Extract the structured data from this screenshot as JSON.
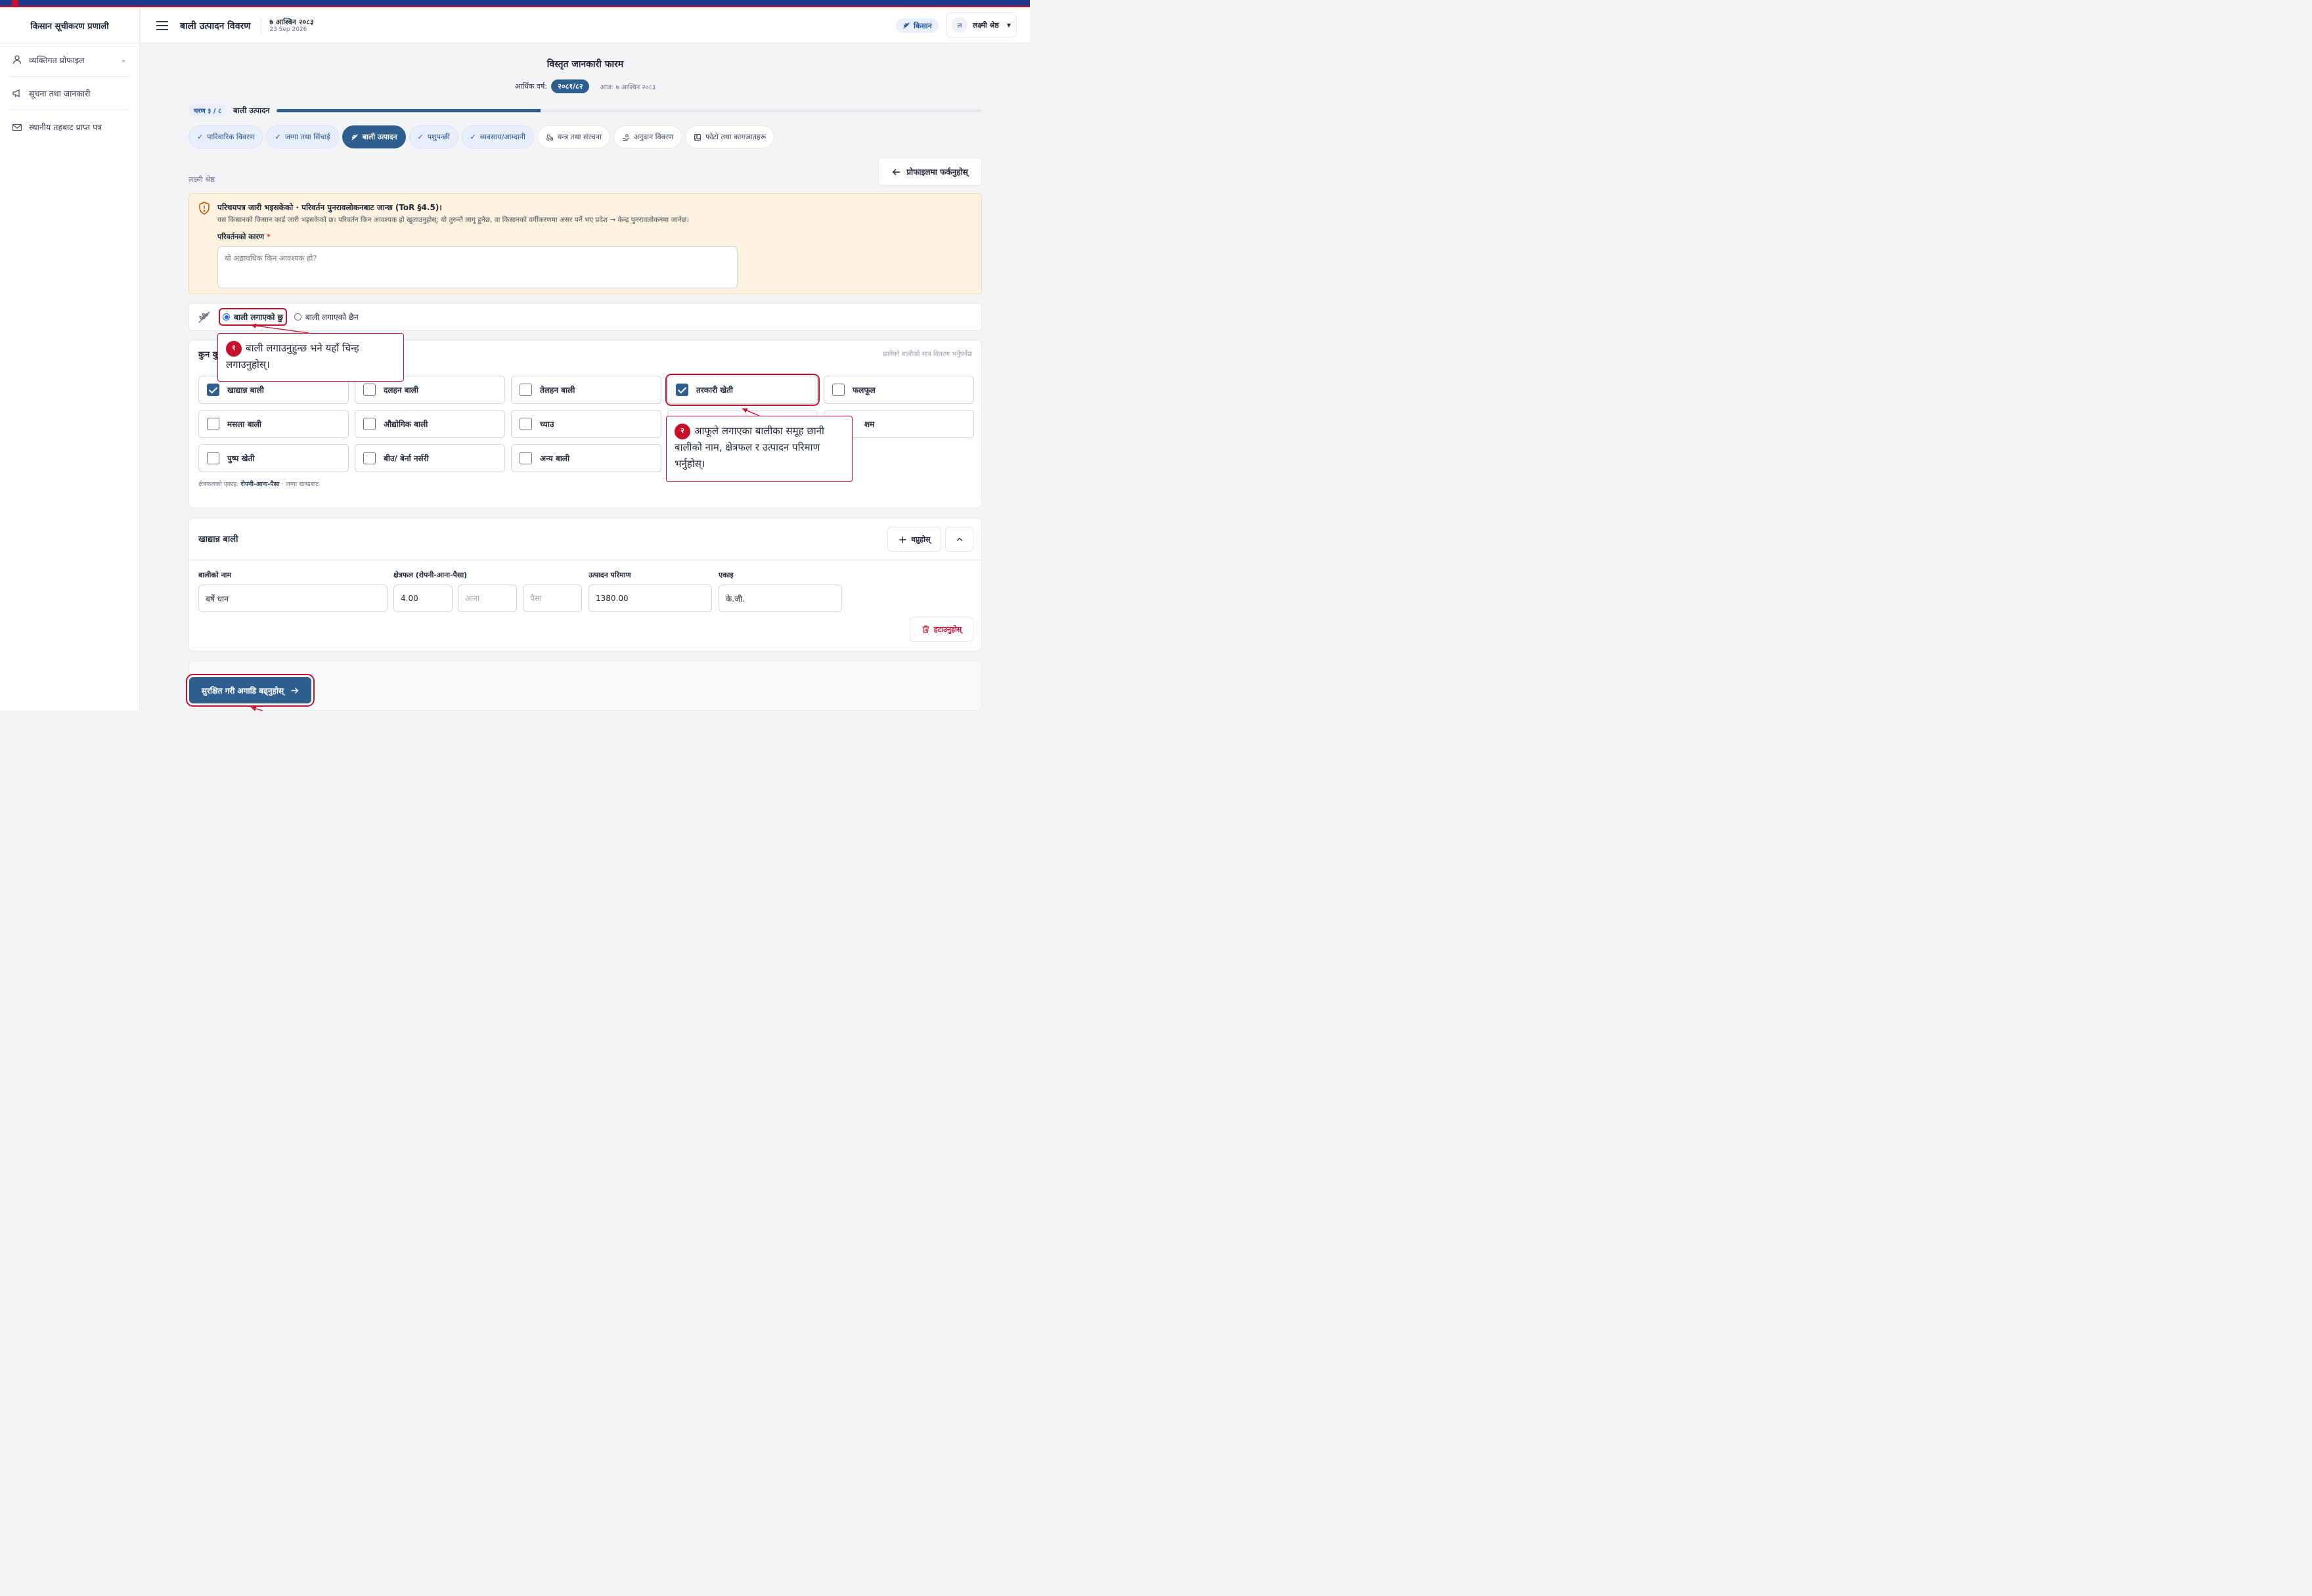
{
  "app": {
    "name": "किसान सूचीकरण प्रणाली"
  },
  "sidebar": {
    "items": [
      {
        "label": "व्यक्तिगत प्रोफाइल",
        "icon": "user-icon"
      },
      {
        "label": "सूचना तथा जानकारी",
        "icon": "megaphone-icon"
      },
      {
        "label": "स्थानीय तहबाट प्राप्त पत्र",
        "icon": "mail-icon"
      }
    ]
  },
  "header": {
    "title": "बाली उत्पादन विवरण",
    "date_np": "७ आश्विन २०८३",
    "date_en": "23 Sep 2026",
    "role_label": "किसान",
    "user_initial": "ल",
    "user_name": "लक्ष्मी श्रेष्ठ"
  },
  "form": {
    "title": "विस्तृत जानकारी फारम",
    "fy_label": "आर्थिक वर्ष:",
    "fy_value": "२०८१/८२",
    "today": "आज: ७ आश्विन २०८३",
    "step_badge": "चरण ३ / ८",
    "step_name": "बाली उत्पादन",
    "progress": 0.375,
    "farmer_name": "लक्ष्मी श्रेष्ठ",
    "back_label": "प्रोफाइलमा फर्कनुहोस्"
  },
  "tabs": [
    {
      "label": "पारिवारिक विवरण",
      "state": "done"
    },
    {
      "label": "जग्गा तथा सिंचाई",
      "state": "done"
    },
    {
      "label": "बाली उत्पादन",
      "state": "active"
    },
    {
      "label": "पशुपन्छी",
      "state": "done"
    },
    {
      "label": "व्यवसाय/आम्दानी",
      "state": "done"
    },
    {
      "label": "यन्त्र तथा संरचना",
      "state": "pending"
    },
    {
      "label": "अनुदान विवरण",
      "state": "pending"
    },
    {
      "label": "फोटो तथा कागजातहरू",
      "state": "pending"
    }
  ],
  "warning": {
    "title": "परिचयपत्र जारी भइसकेको · परिवर्तन पुनरावलोकनबाट जान्छ (ToR §4.5)।",
    "text": "यस किसानको किसान कार्ड जारी भइसकेको छ। परिवर्तन किन आवश्यक हो खुलाउनुहोस्; यो तुरुन्तै लागू हुनेछ, वा किसानको वर्गीकरणमा असर पर्ने भए प्रदेश → केन्द्र पुनरावलोकनमा जानेछ।",
    "reason_label": "परिवर्तनको कारण",
    "reason_required": "*",
    "reason_placeholder": "यो अद्यावधिक किन आवश्यक हो?"
  },
  "crop_status": {
    "yes_label": "बाली लगाएको छु",
    "no_label": "बाली लगाएको छैन",
    "selected": "yes"
  },
  "crop_groups": {
    "heading": "कुन कु",
    "hint": "छानेको बालीको मात्र विवरण भर्नुपर्नेछ",
    "items": [
      {
        "label": "खाद्यान्न बाली",
        "checked": true
      },
      {
        "label": "दलहन बाली",
        "checked": false
      },
      {
        "label": "तेलहन बाली",
        "checked": false
      },
      {
        "label": "तरकारी खेती",
        "checked": true
      },
      {
        "label": "फलफूल",
        "checked": false
      },
      {
        "label": "मसला बाली",
        "checked": false
      },
      {
        "label": "औद्योगिक बाली",
        "checked": false
      },
      {
        "label": "च्याउ",
        "checked": false
      },
      {
        "label": "",
        "checked": false
      },
      {
        "label": "शम",
        "checked": false
      },
      {
        "label": "पुष्प खेती",
        "checked": false
      },
      {
        "label": "बीउ/ बेर्ना नर्सरी",
        "checked": false
      },
      {
        "label": "अन्य बाली",
        "checked": false
      }
    ],
    "unit_note_prefix": "क्षेत्रफलको एकाइ:",
    "unit_note_unit": "रोपनी-आना-पैसा",
    "unit_note_suffix": "· जग्गा खण्डबाट"
  },
  "cereal_section": {
    "title": "खाद्यान्न बाली",
    "add_label": "थप्नुहोस्",
    "crop_name_label": "बालीको नाम",
    "crop_name_value": "बर्षे धान",
    "area_label": "क्षेत्रफल (रोपनी-आना-पैसा)",
    "area_ropani": "4.00",
    "area_aana_placeholder": "आना",
    "area_paisa_placeholder": "पैसा",
    "production_label": "उत्पादन परिमाण",
    "production_value": "1380.00",
    "unit_label": "एकाइ",
    "unit_value": "के.जी.",
    "delete_label": "हटाउनुहोस्"
  },
  "footer": {
    "save_label": "सुरक्षित गरी अगाडि बढ्नुहोस्"
  },
  "callouts": [
    {
      "num": "१",
      "text": "बाली लगाउनुहुन्छ भने यहाँ चिन्ह लगाउनुहोस्।"
    },
    {
      "num": "२",
      "text": "आफूले लगाएका बालीका समूह छानी बालीको नाम, क्षेत्रफल र उत्पादन परिमाण भर्नुहोस्।"
    }
  ],
  "colors": {
    "primary": "#2f5f8f",
    "annotation": "#c8102e",
    "warning_bg": "#fdf2e0"
  }
}
